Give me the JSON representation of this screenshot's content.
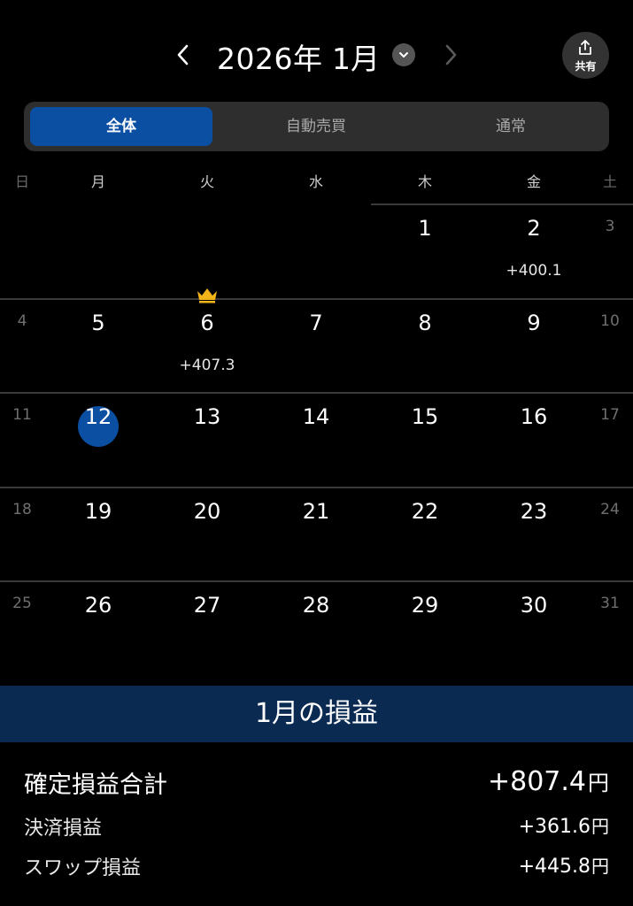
{
  "header": {
    "year": "2026年",
    "month": "1月",
    "share_label": "共有"
  },
  "tabs": [
    {
      "label": "全体",
      "active": true
    },
    {
      "label": "自動売買",
      "active": false
    },
    {
      "label": "通常",
      "active": false
    }
  ],
  "weekdays": [
    "日",
    "月",
    "火",
    "水",
    "木",
    "金",
    "土"
  ],
  "weeks": [
    [
      {
        "d": "",
        "pl": ""
      },
      {
        "d": "",
        "pl": ""
      },
      {
        "d": "",
        "pl": ""
      },
      {
        "d": "",
        "pl": ""
      },
      {
        "d": "1",
        "pl": ""
      },
      {
        "d": "2",
        "pl": "+400.1"
      },
      {
        "d": "3",
        "pl": ""
      }
    ],
    [
      {
        "d": "4",
        "pl": ""
      },
      {
        "d": "5",
        "pl": ""
      },
      {
        "d": "6",
        "pl": "+407.3",
        "crown": true
      },
      {
        "d": "7",
        "pl": ""
      },
      {
        "d": "8",
        "pl": ""
      },
      {
        "d": "9",
        "pl": ""
      },
      {
        "d": "10",
        "pl": ""
      }
    ],
    [
      {
        "d": "11",
        "pl": ""
      },
      {
        "d": "12",
        "pl": "",
        "today": true
      },
      {
        "d": "13",
        "pl": ""
      },
      {
        "d": "14",
        "pl": ""
      },
      {
        "d": "15",
        "pl": ""
      },
      {
        "d": "16",
        "pl": ""
      },
      {
        "d": "17",
        "pl": ""
      }
    ],
    [
      {
        "d": "18",
        "pl": ""
      },
      {
        "d": "19",
        "pl": ""
      },
      {
        "d": "20",
        "pl": ""
      },
      {
        "d": "21",
        "pl": ""
      },
      {
        "d": "22",
        "pl": ""
      },
      {
        "d": "23",
        "pl": ""
      },
      {
        "d": "24",
        "pl": ""
      }
    ],
    [
      {
        "d": "25",
        "pl": ""
      },
      {
        "d": "26",
        "pl": ""
      },
      {
        "d": "27",
        "pl": ""
      },
      {
        "d": "28",
        "pl": ""
      },
      {
        "d": "29",
        "pl": ""
      },
      {
        "d": "30",
        "pl": ""
      },
      {
        "d": "31",
        "pl": ""
      }
    ]
  ],
  "summary": {
    "title": "1月の損益",
    "total_label": "確定損益合計",
    "total_value": "+807.4",
    "settlement_label": "決済損益",
    "settlement_value": "+361.6",
    "swap_label": "スワップ損益",
    "swap_value": "+445.8",
    "unit": "円"
  },
  "colors": {
    "accent": "#0b4fa3",
    "summary_header": "#0a2a52",
    "crown": "#f2b418"
  },
  "icons": {
    "prev": "chevron-left-icon",
    "next": "chevron-right-icon",
    "dropdown": "chevron-down-icon",
    "share": "share-icon",
    "crown": "crown-icon"
  }
}
